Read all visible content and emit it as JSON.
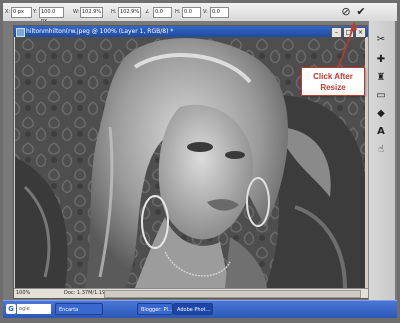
{
  "options_bar": {
    "x_value": "0 px",
    "y_value": "100.0 px",
    "w_value": "102.9%",
    "h_value": "102.9%",
    "angle_value": "0.0",
    "h_skew": "0.0",
    "v_skew": "0.0",
    "x_label": "X:",
    "y_label": "Y:",
    "w_label": "W:",
    "h_label": "H:",
    "angle_label": "∠",
    "hs_label": "H:",
    "vs_label": "V:",
    "cancel_icon": "cancel-icon",
    "commit_icon": "commit-checkmark-icon"
  },
  "document": {
    "title": "hiltonmhilton(rw.jpeg @ 100% (Layer 1, RGB/8) *",
    "zoom": "100%",
    "doc_info": "Doc: 1.37M/1.19M"
  },
  "annotation": {
    "line1": "Click After",
    "line2": "Resize"
  },
  "taskbar": {
    "logo": "G",
    "search_text": "ogle",
    "item1": "Encarta",
    "item2": "Blogger: Pl...",
    "item3": "Adobe Phot..."
  },
  "colors": {
    "annotation_red": "#c0392b",
    "taskbar_blue": "#2c57b7",
    "titlebar_blue": "#1f4aa0"
  }
}
